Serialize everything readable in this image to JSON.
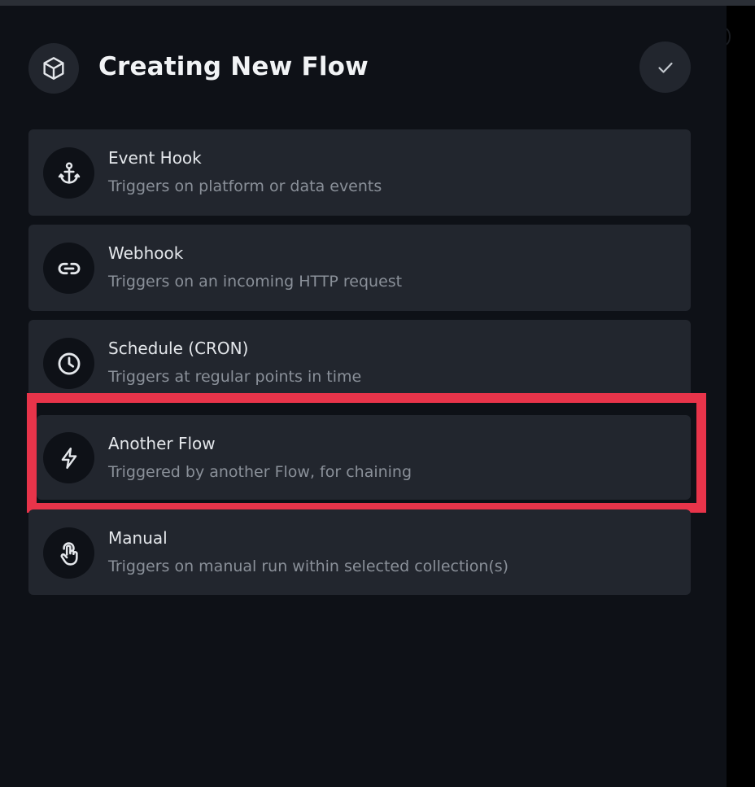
{
  "header": {
    "title": "Creating New Flow",
    "icon": "cube-icon",
    "done_icon": "check-icon"
  },
  "options": [
    {
      "title": "Event Hook",
      "description": "Triggers on platform or data events",
      "icon": "anchor-icon"
    },
    {
      "title": "Webhook",
      "description": "Triggers on an incoming HTTP request",
      "icon": "link-icon"
    },
    {
      "title": "Schedule (CRON)",
      "description": "Triggers at regular points in time",
      "icon": "clock-icon"
    },
    {
      "title": "Another Flow",
      "description": "Triggered by another Flow, for chaining",
      "icon": "lightning-icon"
    },
    {
      "title": "Manual",
      "description": "Triggers on manual run within selected collection(s)",
      "icon": "touch-icon"
    }
  ],
  "colors": {
    "background": "#0e1117",
    "card": "#22262e",
    "highlight": "#e8344a"
  }
}
